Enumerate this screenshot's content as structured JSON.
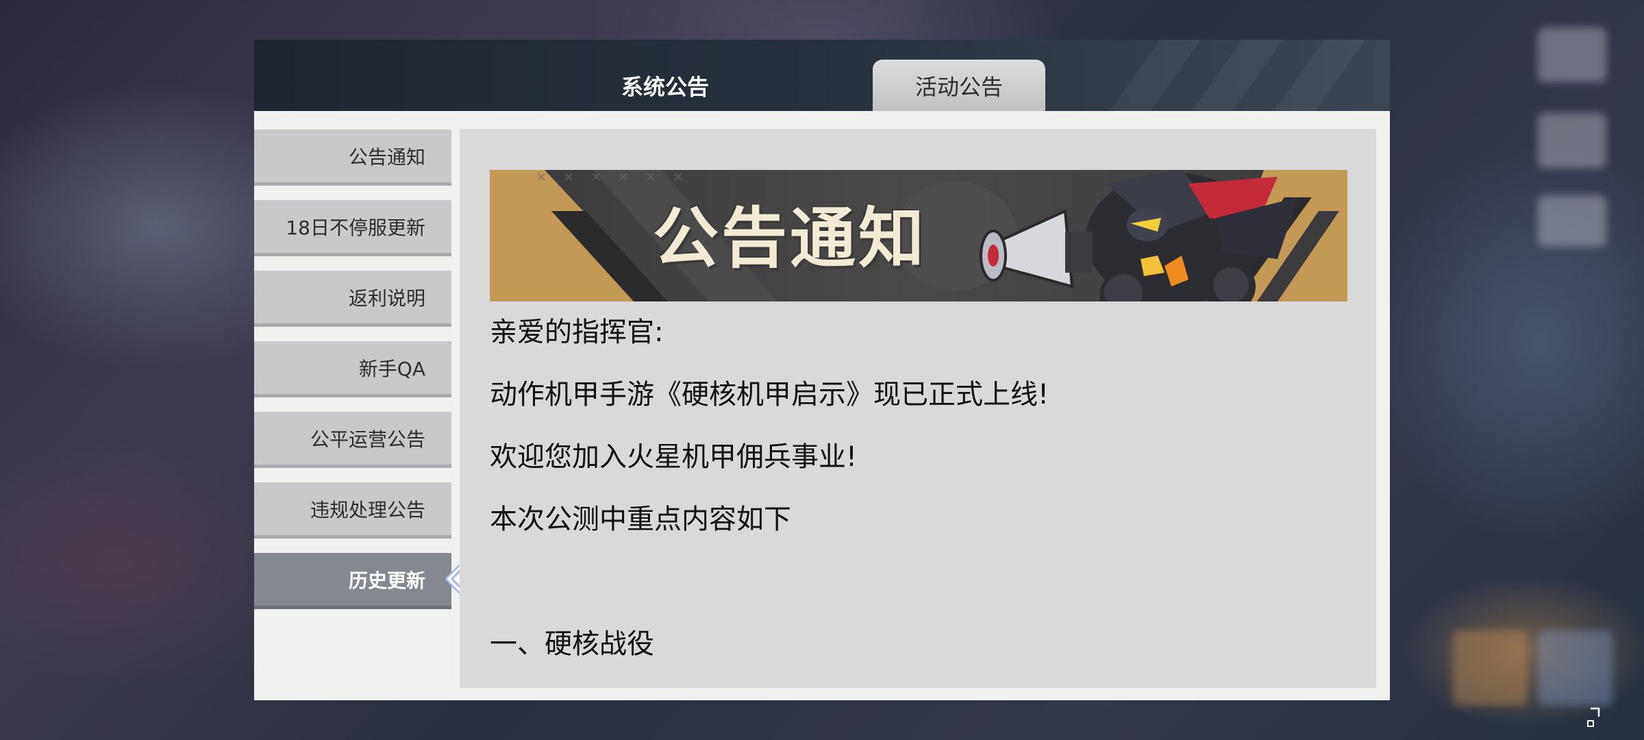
{
  "header": {
    "tabs": [
      {
        "label": "系统公告",
        "active": true
      },
      {
        "label": "活动公告",
        "active": false
      }
    ]
  },
  "sidebar": {
    "items": [
      {
        "label": "公告通知"
      },
      {
        "label": "18日不停服更新"
      },
      {
        "label": "返利说明"
      },
      {
        "label": "新手QA"
      },
      {
        "label": "公平运营公告"
      },
      {
        "label": "违规处理公告"
      },
      {
        "label": "历史更新",
        "active": true
      }
    ]
  },
  "content": {
    "banner_title": "公告通知",
    "lines": [
      "亲爱的指挥官:",
      "动作机甲手游《硬核机甲启示》现已正式上线!",
      "欢迎您加入火星机甲佣兵事业!",
      "本次公测中重点内容如下",
      "一、硬核战役"
    ]
  },
  "colors": {
    "header_bg": "#1e2630",
    "sidebar_item": "#c8c9cb",
    "sidebar_active": "#848991",
    "content_bg": "#d9d9d9",
    "banner_gold": "#c29a55"
  },
  "icons": {
    "active_indicator": "chevron-left-icon",
    "corner": "resize-icon"
  }
}
